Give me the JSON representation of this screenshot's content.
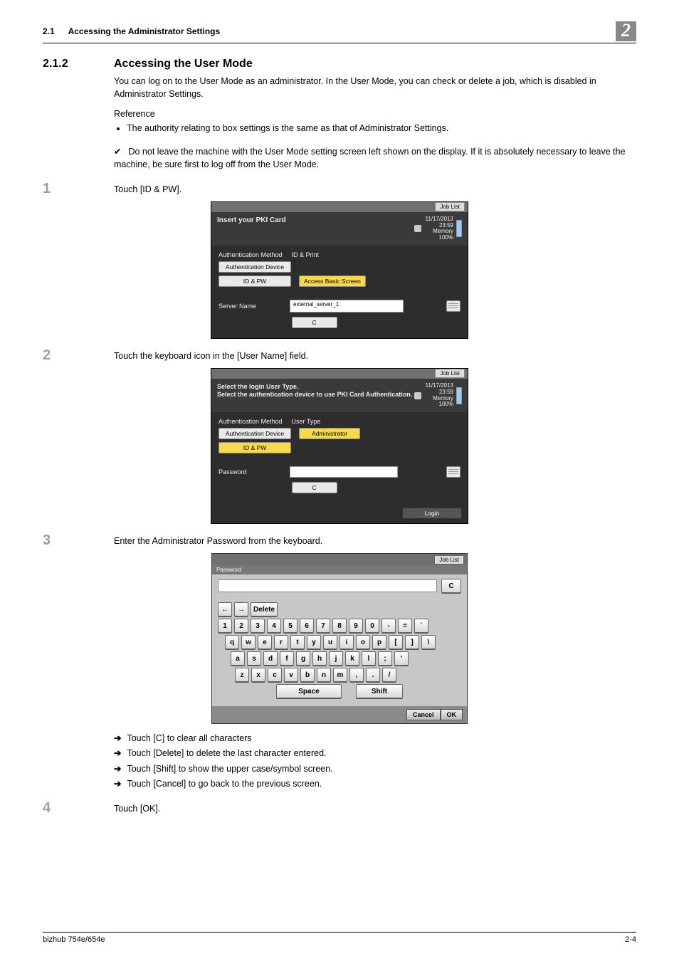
{
  "runhead": {
    "secno": "2.1",
    "title": "Accessing the Administrator Settings",
    "chapter": "2"
  },
  "heading": {
    "num": "2.1.2",
    "title": "Accessing the User Mode"
  },
  "intro": "You can log on to the User Mode as an administrator. In the User Mode, you can check or delete a job, which is disabled in Administrator Settings.",
  "reference_label": "Reference",
  "bullets": [
    "The authority relating to box settings is the same as that of Administrator Settings."
  ],
  "checks": [
    "Do not leave the machine with the User Mode setting screen left shown on the display. If it is absolutely necessary to leave the machine, be sure first to log off from the User Mode."
  ],
  "steps": {
    "s1": {
      "num": "1",
      "text": "Touch [ID & PW]."
    },
    "s2": {
      "num": "2",
      "text": "Touch the keyboard icon in the [User Name] field."
    },
    "s3": {
      "num": "3",
      "text": "Enter the Administrator Password from the keyboard."
    },
    "s4": {
      "num": "4",
      "text": "Touch [OK]."
    }
  },
  "arrows": [
    "Touch [C] to clear all characters",
    "Touch [Delete] to delete the last character entered.",
    "Touch [Shift] to show the upper case/symbol screen.",
    "Touch [Cancel] to go back to the previous screen."
  ],
  "shot_common": {
    "joblist": "Job List",
    "date": "11/17/2013",
    "time": "23:59",
    "mem": "Memory",
    "pct": "100%"
  },
  "shot1": {
    "title": "Insert your PKI Card",
    "auth_method_lbl": "Authentication Method",
    "auth_method_val": "ID & Print",
    "auth_device_btn": "Authentication Device",
    "idpw_btn": "ID & PW",
    "access_btn": "Access Basic Screen",
    "server_lbl": "Server Name",
    "server_val": "external_server_1",
    "c_btn": "C"
  },
  "shot2": {
    "title1": "Select the login User Type.",
    "title2": "Select the authentication device to use PKI Card Authentication.",
    "auth_method_lbl": "Authentication Method",
    "user_type_lbl": "User Type",
    "auth_device_btn": "Authentication Device",
    "admin_btn": "Administrator",
    "idpw_btn": "ID & PW",
    "password_lbl": "Password",
    "c_btn": "C",
    "login_btn": "Login"
  },
  "kbshot": {
    "pwd_label": "Password",
    "joblist": "Job List",
    "c_btn": "C",
    "row_top": {
      "left": "←",
      "right": "→",
      "delete": "Delete"
    },
    "row1": [
      "1",
      "2",
      "3",
      "4",
      "5",
      "6",
      "7",
      "8",
      "9",
      "0",
      "-",
      "=",
      "`"
    ],
    "row2": [
      "q",
      "w",
      "e",
      "r",
      "t",
      "y",
      "u",
      "i",
      "o",
      "p",
      "[",
      "]",
      "\\"
    ],
    "row3": [
      "a",
      "s",
      "d",
      "f",
      "g",
      "h",
      "j",
      "k",
      "l",
      ";",
      "'"
    ],
    "row4": [
      "z",
      "x",
      "c",
      "v",
      "b",
      "n",
      "m",
      ",",
      ".",
      "/"
    ],
    "space": "Space",
    "shift": "Shift",
    "cancel": "Cancel",
    "ok": "OK"
  },
  "footer": {
    "left": "bizhub 754e/654e",
    "right": "2-4"
  }
}
